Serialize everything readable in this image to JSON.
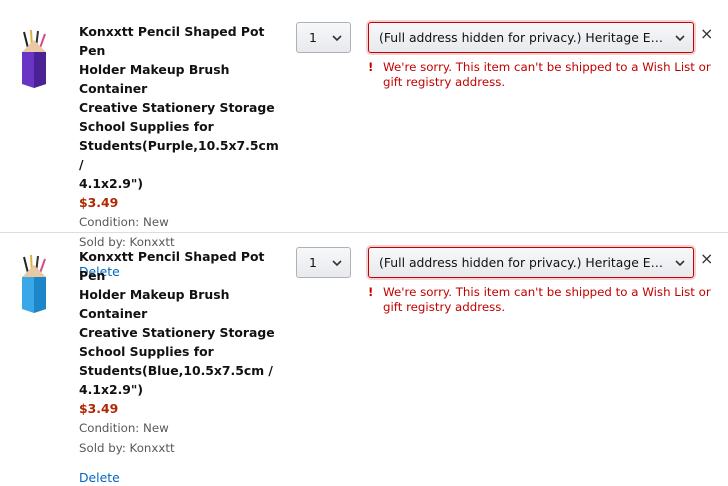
{
  "colors": {
    "price": "#b12704",
    "link": "#0066c0",
    "error": "#c40000",
    "text": "#111111",
    "muted": "#565959"
  },
  "items": [
    {
      "title": "Konxxtt Pencil Shaped Pot Pen\nHolder Makeup Brush Container\nCreative Stationery Storage\nSchool Supplies for\nStudents(Purple,10.5x7.5cm /\n4.1x2.9\")",
      "price": "$3.49",
      "condition": "Condition: New",
      "sold_by": "Sold by: Konxxtt",
      "delete_label": "Delete",
      "quantity": "1",
      "address": "(Full address hidden for privacy.) Heritage Ele...",
      "error_icon": "!",
      "error": "We're sorry. This item can't be shipped to a Wish List or gift registry address.",
      "close_icon": "×",
      "thumb_color": "#6a35c4",
      "thumb_color_dark": "#4b2296"
    },
    {
      "title": "Konxxtt Pencil Shaped Pot Pen\nHolder Makeup Brush Container\nCreative Stationery Storage\nSchool Supplies for\nStudents(Blue,10.5x7.5cm /\n4.1x2.9\")",
      "price": "$3.49",
      "condition": "Condition: New",
      "sold_by": "Sold by: Konxxtt",
      "delete_label": "Delete",
      "quantity": "1",
      "address": "(Full address hidden for privacy.) Heritage Ele...",
      "error_icon": "!",
      "error": "We're sorry. This item can't be shipped to a Wish List or gift registry address.",
      "close_icon": "×",
      "thumb_color": "#3aa7e8",
      "thumb_color_dark": "#1d86c9"
    }
  ]
}
